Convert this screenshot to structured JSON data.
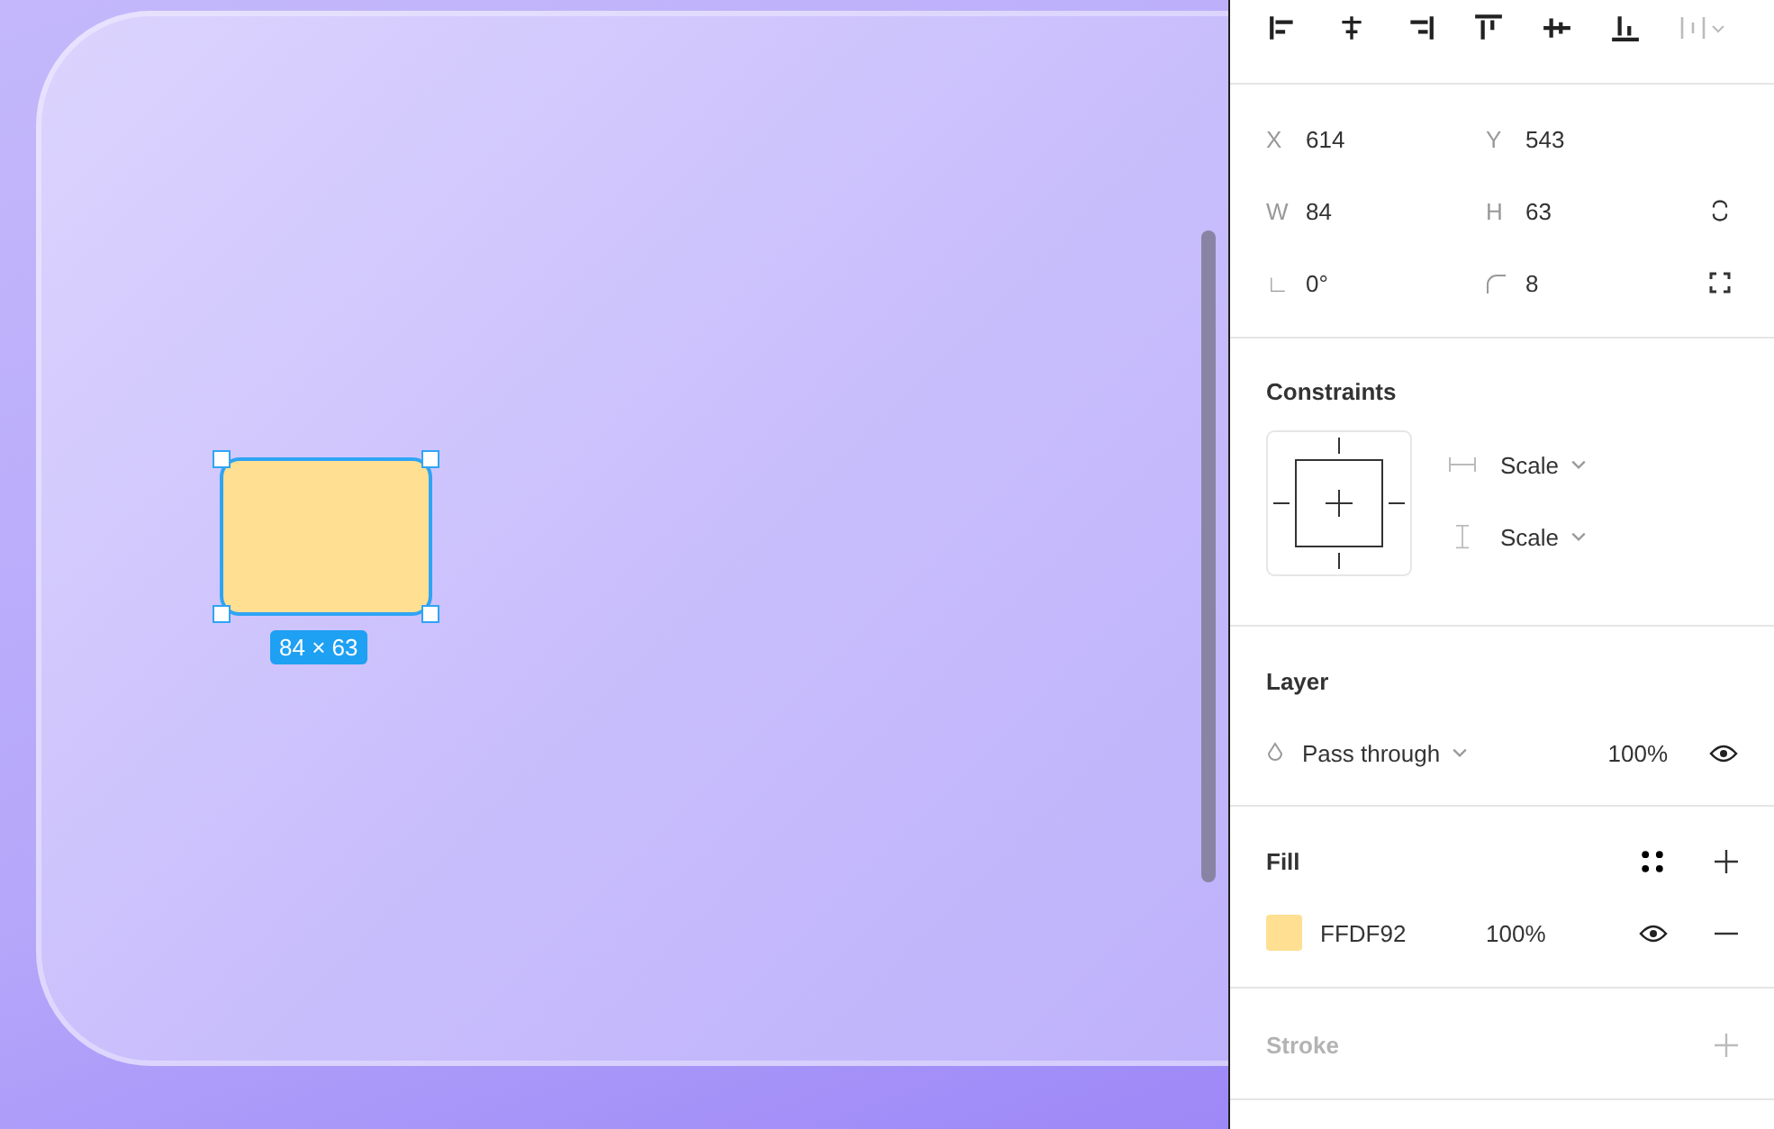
{
  "canvas": {
    "shape": {
      "selected": true,
      "size_label": "84 × 63"
    }
  },
  "panel": {
    "transform": [
      {
        "label": "X",
        "value": "614"
      },
      {
        "label": "Y",
        "value": "543"
      },
      {
        "label": "W",
        "value": "84"
      },
      {
        "label": "H",
        "value": "63"
      },
      {
        "label": "∟",
        "kind": "rotation",
        "value": "0°"
      },
      {
        "kind": "radius",
        "value": "8"
      }
    ],
    "constraints": {
      "title": "Constraints",
      "horizontal": "Scale",
      "vertical": "Scale"
    },
    "layer": {
      "title": "Layer",
      "blend": "Pass through",
      "opacity": "100%",
      "visible": true
    },
    "fill": {
      "title": "Fill",
      "color": "#ffdf92",
      "hex": "FFDF92",
      "opacity": "100%",
      "visible": true
    },
    "stroke": {
      "title": "Stroke",
      "empty": true
    }
  }
}
